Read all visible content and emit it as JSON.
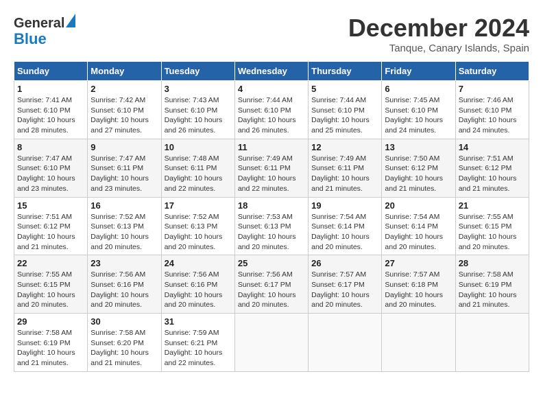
{
  "logo": {
    "line1": "General",
    "line2": "Blue"
  },
  "title": "December 2024",
  "subtitle": "Tanque, Canary Islands, Spain",
  "days_header": [
    "Sunday",
    "Monday",
    "Tuesday",
    "Wednesday",
    "Thursday",
    "Friday",
    "Saturday"
  ],
  "weeks": [
    [
      {
        "day": "1",
        "info": "Sunrise: 7:41 AM\nSunset: 6:10 PM\nDaylight: 10 hours\nand 28 minutes."
      },
      {
        "day": "2",
        "info": "Sunrise: 7:42 AM\nSunset: 6:10 PM\nDaylight: 10 hours\nand 27 minutes."
      },
      {
        "day": "3",
        "info": "Sunrise: 7:43 AM\nSunset: 6:10 PM\nDaylight: 10 hours\nand 26 minutes."
      },
      {
        "day": "4",
        "info": "Sunrise: 7:44 AM\nSunset: 6:10 PM\nDaylight: 10 hours\nand 26 minutes."
      },
      {
        "day": "5",
        "info": "Sunrise: 7:44 AM\nSunset: 6:10 PM\nDaylight: 10 hours\nand 25 minutes."
      },
      {
        "day": "6",
        "info": "Sunrise: 7:45 AM\nSunset: 6:10 PM\nDaylight: 10 hours\nand 24 minutes."
      },
      {
        "day": "7",
        "info": "Sunrise: 7:46 AM\nSunset: 6:10 PM\nDaylight: 10 hours\nand 24 minutes."
      }
    ],
    [
      {
        "day": "8",
        "info": "Sunrise: 7:47 AM\nSunset: 6:10 PM\nDaylight: 10 hours\nand 23 minutes."
      },
      {
        "day": "9",
        "info": "Sunrise: 7:47 AM\nSunset: 6:11 PM\nDaylight: 10 hours\nand 23 minutes."
      },
      {
        "day": "10",
        "info": "Sunrise: 7:48 AM\nSunset: 6:11 PM\nDaylight: 10 hours\nand 22 minutes."
      },
      {
        "day": "11",
        "info": "Sunrise: 7:49 AM\nSunset: 6:11 PM\nDaylight: 10 hours\nand 22 minutes."
      },
      {
        "day": "12",
        "info": "Sunrise: 7:49 AM\nSunset: 6:11 PM\nDaylight: 10 hours\nand 21 minutes."
      },
      {
        "day": "13",
        "info": "Sunrise: 7:50 AM\nSunset: 6:12 PM\nDaylight: 10 hours\nand 21 minutes."
      },
      {
        "day": "14",
        "info": "Sunrise: 7:51 AM\nSunset: 6:12 PM\nDaylight: 10 hours\nand 21 minutes."
      }
    ],
    [
      {
        "day": "15",
        "info": "Sunrise: 7:51 AM\nSunset: 6:12 PM\nDaylight: 10 hours\nand 21 minutes."
      },
      {
        "day": "16",
        "info": "Sunrise: 7:52 AM\nSunset: 6:13 PM\nDaylight: 10 hours\nand 20 minutes."
      },
      {
        "day": "17",
        "info": "Sunrise: 7:52 AM\nSunset: 6:13 PM\nDaylight: 10 hours\nand 20 minutes."
      },
      {
        "day": "18",
        "info": "Sunrise: 7:53 AM\nSunset: 6:13 PM\nDaylight: 10 hours\nand 20 minutes."
      },
      {
        "day": "19",
        "info": "Sunrise: 7:54 AM\nSunset: 6:14 PM\nDaylight: 10 hours\nand 20 minutes."
      },
      {
        "day": "20",
        "info": "Sunrise: 7:54 AM\nSunset: 6:14 PM\nDaylight: 10 hours\nand 20 minutes."
      },
      {
        "day": "21",
        "info": "Sunrise: 7:55 AM\nSunset: 6:15 PM\nDaylight: 10 hours\nand 20 minutes."
      }
    ],
    [
      {
        "day": "22",
        "info": "Sunrise: 7:55 AM\nSunset: 6:15 PM\nDaylight: 10 hours\nand 20 minutes."
      },
      {
        "day": "23",
        "info": "Sunrise: 7:56 AM\nSunset: 6:16 PM\nDaylight: 10 hours\nand 20 minutes."
      },
      {
        "day": "24",
        "info": "Sunrise: 7:56 AM\nSunset: 6:16 PM\nDaylight: 10 hours\nand 20 minutes."
      },
      {
        "day": "25",
        "info": "Sunrise: 7:56 AM\nSunset: 6:17 PM\nDaylight: 10 hours\nand 20 minutes."
      },
      {
        "day": "26",
        "info": "Sunrise: 7:57 AM\nSunset: 6:17 PM\nDaylight: 10 hours\nand 20 minutes."
      },
      {
        "day": "27",
        "info": "Sunrise: 7:57 AM\nSunset: 6:18 PM\nDaylight: 10 hours\nand 20 minutes."
      },
      {
        "day": "28",
        "info": "Sunrise: 7:58 AM\nSunset: 6:19 PM\nDaylight: 10 hours\nand 21 minutes."
      }
    ],
    [
      {
        "day": "29",
        "info": "Sunrise: 7:58 AM\nSunset: 6:19 PM\nDaylight: 10 hours\nand 21 minutes."
      },
      {
        "day": "30",
        "info": "Sunrise: 7:58 AM\nSunset: 6:20 PM\nDaylight: 10 hours\nand 21 minutes."
      },
      {
        "day": "31",
        "info": "Sunrise: 7:59 AM\nSunset: 6:21 PM\nDaylight: 10 hours\nand 22 minutes."
      },
      {
        "day": "",
        "info": ""
      },
      {
        "day": "",
        "info": ""
      },
      {
        "day": "",
        "info": ""
      },
      {
        "day": "",
        "info": ""
      }
    ]
  ]
}
